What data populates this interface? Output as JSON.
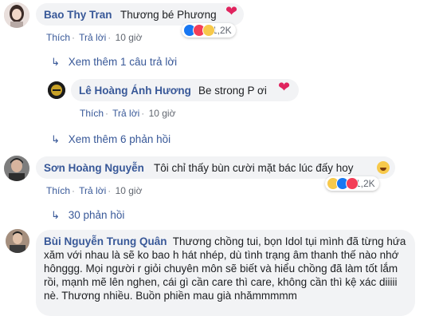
{
  "comments": [
    {
      "author": "Bao Thy Tran",
      "text": "Thương bé Phương",
      "emoji": "red-heart",
      "actions": {
        "like": "Thích",
        "reply": "Trả lời",
        "time": "10 giờ"
      },
      "reactions": {
        "icons": [
          "like",
          "love",
          "haha"
        ],
        "count": "1,2K"
      },
      "view_more": "Xem thêm 1 câu trả lời"
    },
    {
      "author": "Lê Hoàng Ánh Hương",
      "text": "Be strong P ơi",
      "emoji": "red-heart",
      "actions": {
        "like": "Thích",
        "reply": "Trả lời",
        "time": "10 giờ"
      },
      "view_more": "Xem thêm 6 phản hồi"
    },
    {
      "author": "Sơn Hoàng Nguyễn",
      "text": "Tôi chỉ thấy bùn cười mặt bác lúc đấy hoy",
      "emoji": "laughing-face",
      "actions": {
        "like": "Thích",
        "reply": "Trả lời",
        "time": "10 giờ"
      },
      "reactions": {
        "icons": [
          "haha",
          "like",
          "love"
        ],
        "count": "1,2K"
      },
      "view_more": "30 phản hồi"
    },
    {
      "author": "Bùi Nguyễn Trung Quân",
      "text": "Thương chồng tui, bọn Idol tụi mình đã từng hứa xăm với nhau là sẽ ko bao h hát nhép, dù tình trạng âm thanh thế nào nhớ hônggg. Mọi người r giỏi chuyên môn sẽ biết và hiểu chồng đã làm tốt lắm rồi, mạnh mẽ lên nghen, cái gì cần care thì care, không cần thì kệ xác diiiii nè. Thương nhiều. Buồn phiền mau già nhămmmmm"
    }
  ],
  "colors": {
    "name": "#385898",
    "bubble": "#f2f3f5",
    "meta": "#616770"
  }
}
